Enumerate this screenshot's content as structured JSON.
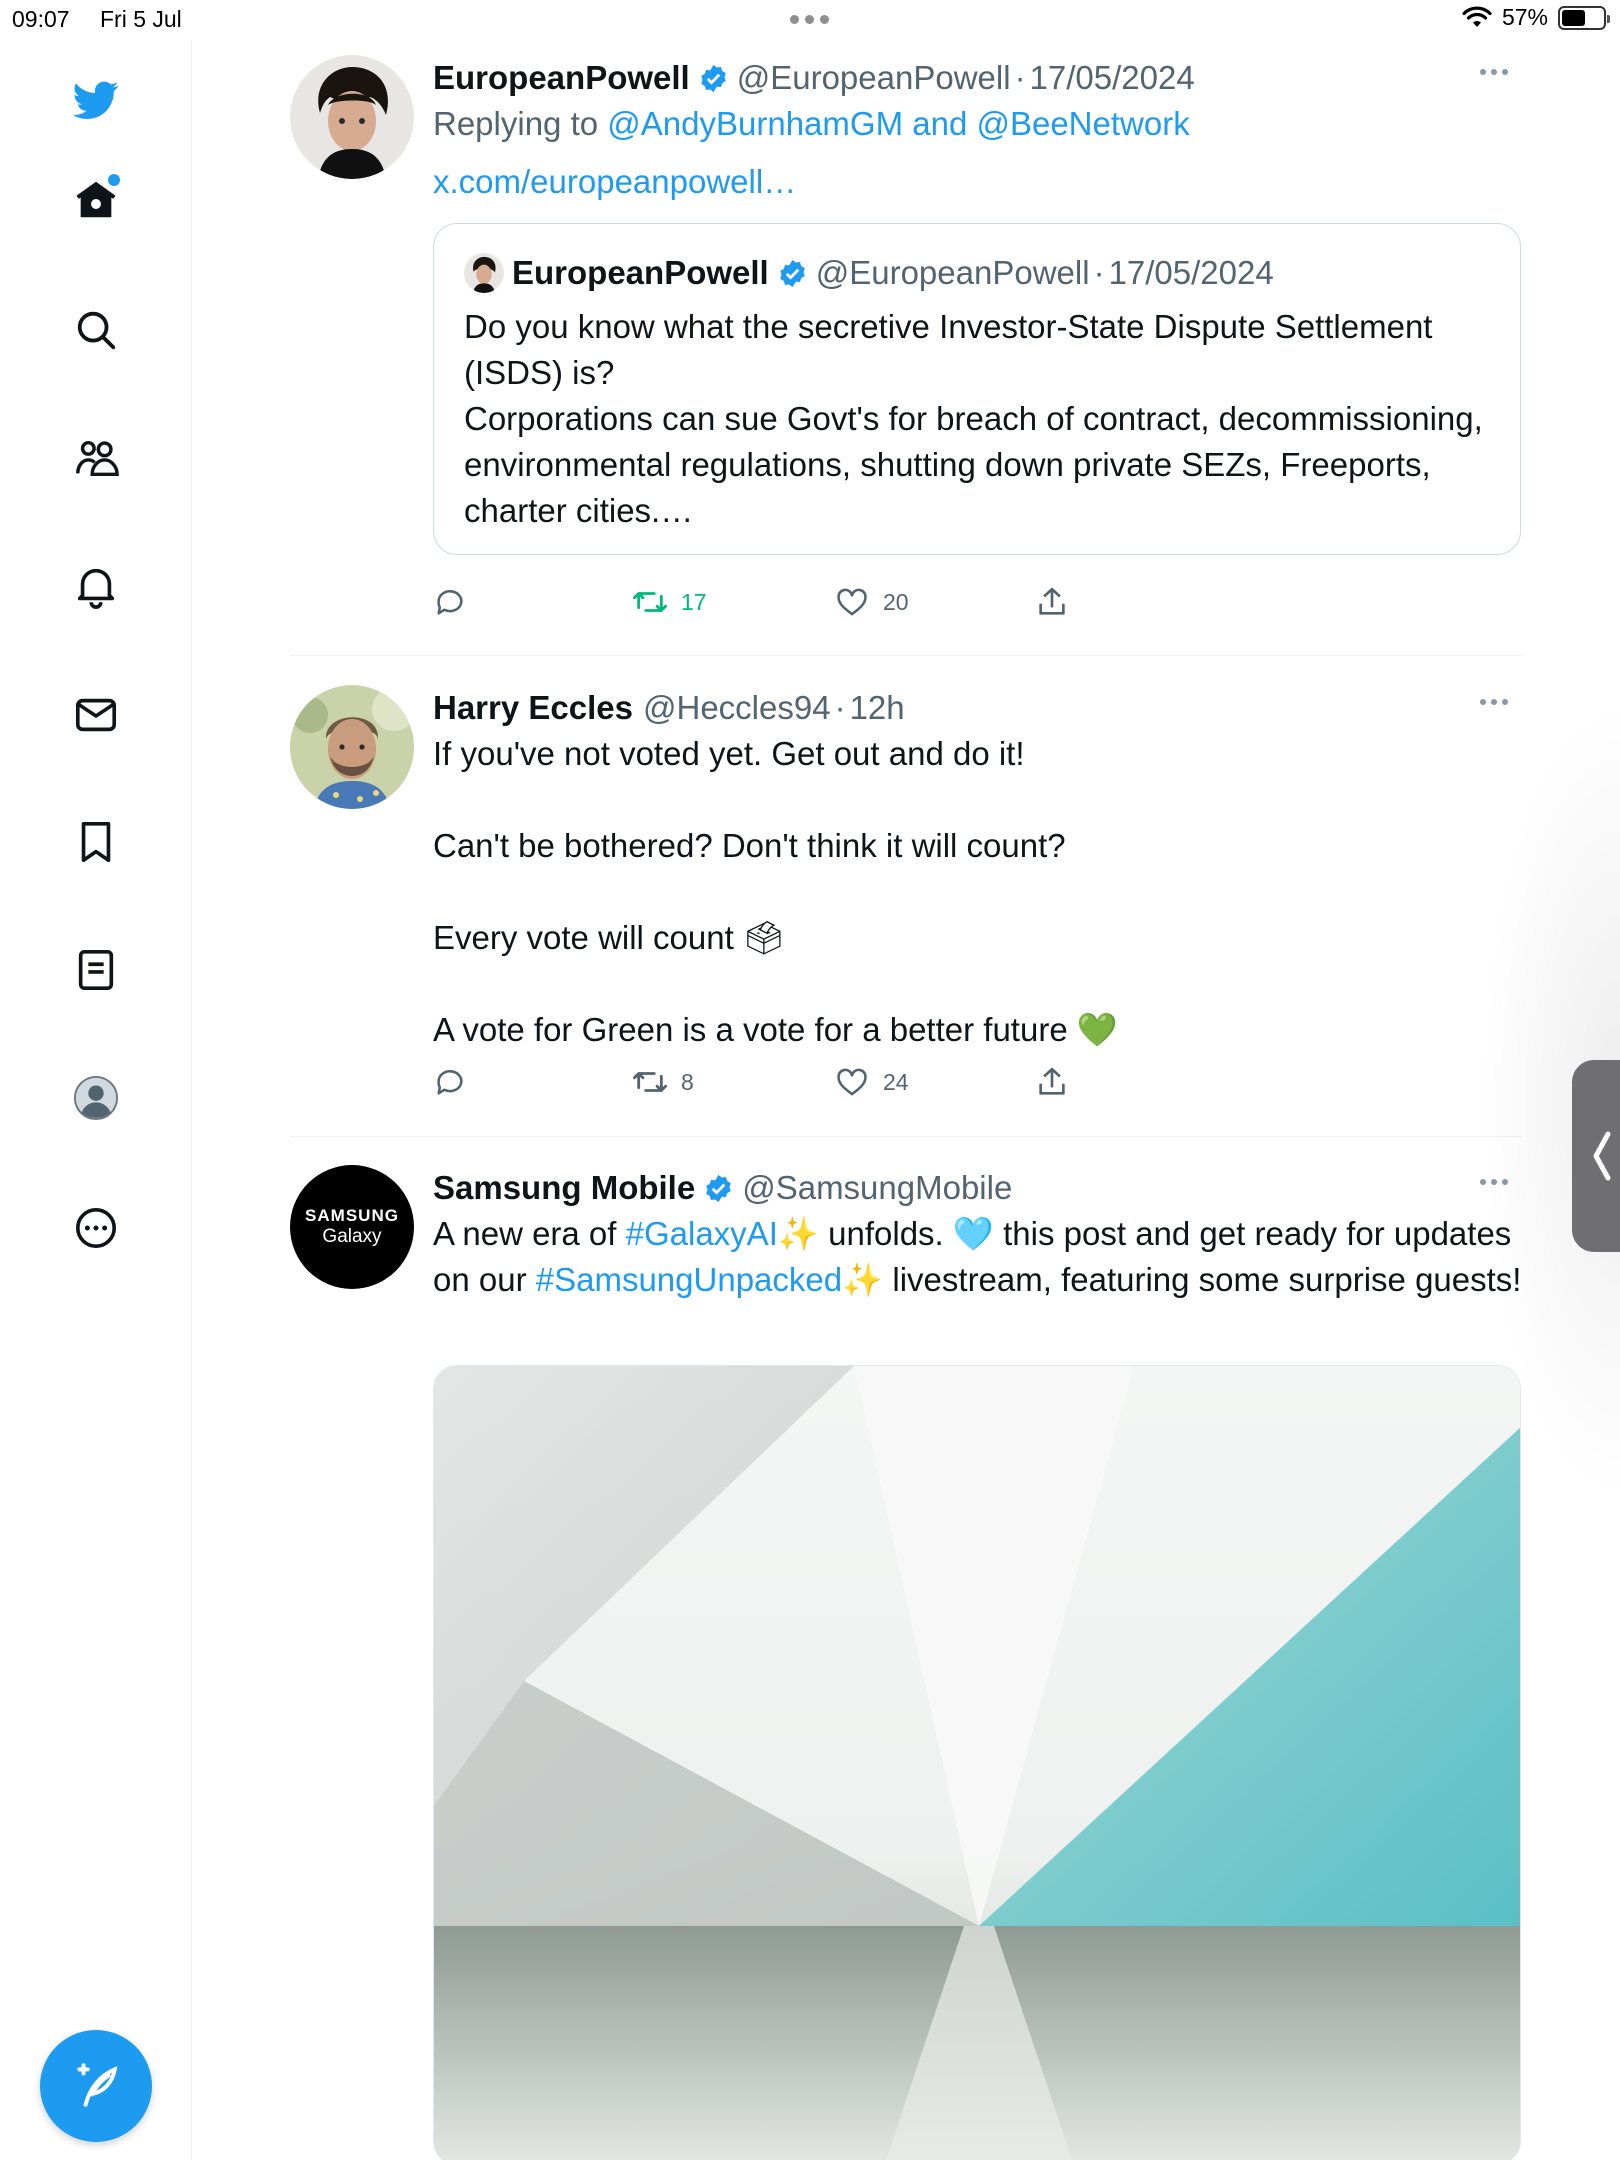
{
  "status_bar": {
    "time": "09:07",
    "date": "Fri 5 Jul",
    "battery": "57%",
    "battery_level": 0.57
  },
  "sidebar": {
    "items": [
      {
        "name": "twitter-logo"
      },
      {
        "name": "home",
        "has_dot": true
      },
      {
        "name": "search"
      },
      {
        "name": "communities"
      },
      {
        "name": "notifications"
      },
      {
        "name": "messages"
      },
      {
        "name": "bookmarks"
      },
      {
        "name": "lists"
      },
      {
        "name": "profile"
      },
      {
        "name": "more"
      }
    ]
  },
  "colors": {
    "accent": "#1d9bf0",
    "text": "#0f1419",
    "secondary": "#536471",
    "retweet_active": "#00ba7c"
  },
  "tweets": [
    {
      "name": "EuropeanPowell",
      "handle": "@EuropeanPowell",
      "sep": "·",
      "date": "17/05/2024",
      "reply_prefix": "Replying to",
      "reply_user1": "@AndyBurnhamGM",
      "reply_and": "and",
      "reply_user2": "@BeeNetwork",
      "link": "x.com/europeanpowell…",
      "quote": {
        "name": "EuropeanPowell",
        "handle": "@EuropeanPowell",
        "sep": "·",
        "date": "17/05/2024",
        "text": "Do you know what the secretive Investor-State Dispute Settlement (ISDS) is?\nCorporations can sue Govt's for breach of contract, decommissioning, environmental regulations, shutting down private SEZs, Freeports, charter cities.…"
      },
      "retweets": "17",
      "likes": "20"
    },
    {
      "name": "Harry Eccles",
      "handle": "@Heccles94",
      "sep": "·",
      "time": "12h",
      "line1": "If you've not voted yet. Get out and do it!",
      "line2": "Can't be bothered? Don't think it will count?",
      "line3": "Every vote will count 🗳",
      "line4": "A vote for Green is a vote for a better future 💚",
      "retweets": "8",
      "likes": "24"
    },
    {
      "name": "Samsung Mobile",
      "handle": "@SamsungMobile",
      "avatar_text1": "SAMSUNG",
      "avatar_text2": "Galaxy",
      "t1": "A new era of ",
      "tag1": "#GalaxyAI",
      "t2": "✨ unfolds. 🩵 this post and get ready for updates on our ",
      "tag2": "#SamsungUnpacked",
      "t3": "✨ livestream, featuring some surprise guests!"
    }
  ]
}
